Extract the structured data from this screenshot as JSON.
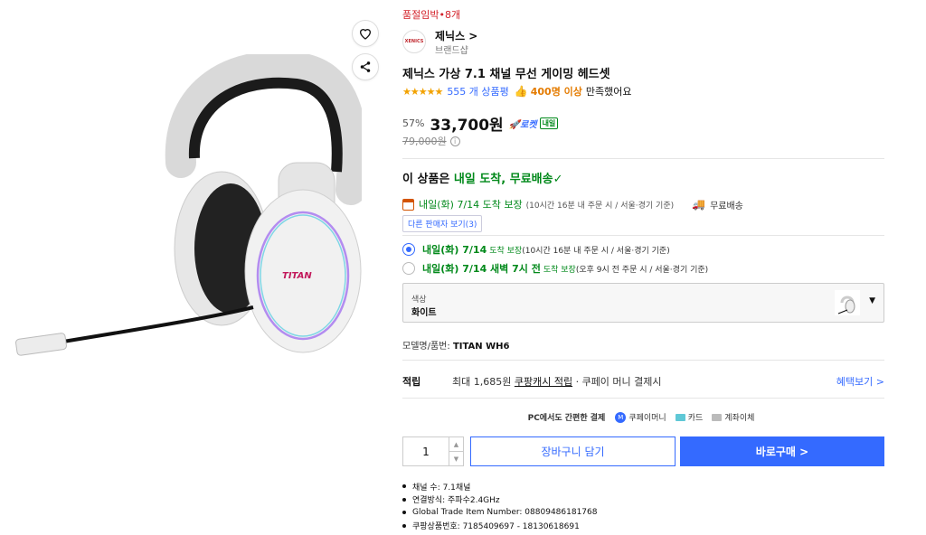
{
  "product_image": {
    "logo_text": "TITAN"
  },
  "actions": {
    "wishlist_icon": "heart-icon",
    "share_icon": "share-icon"
  },
  "sold_badge": "품절임박•8개",
  "brand": {
    "logo_text": "XENICS",
    "name": "제닉스 >",
    "sub": "브랜드샵"
  },
  "title": "제닉스 가상 7.1 채널 무선 게이밍 헤드셋",
  "rating": {
    "stars": "★★★★★",
    "count_text": "555 개 상품평",
    "satisfied_num": "400명 이상",
    "satisfied_text": "만족했어요"
  },
  "price": {
    "discount": "57%",
    "sale": "33,700원",
    "rocket_label": "로켓",
    "naeil_label": "내일",
    "original": "79,000원"
  },
  "shipping": {
    "head_prefix": "이 상품은",
    "head_green": "내일 도착, 무료배송✓",
    "arrive_main": "내일(화) 7/14 도착 보장",
    "arrive_note": "(10시간 16분 내 주문 시 / 서울·경기 기준)",
    "free_ship": "무료배송",
    "other_seller": "다른 판매자 보기(3)"
  },
  "options": [
    {
      "main": "내일(화) 7/14",
      "tag": "도착 보장",
      "note": "(10시간 16분 내 주문 시 / 서울·경기 기준)",
      "selected": true
    },
    {
      "main": "내일(화) 7/14 새벽 7시 전",
      "tag": "도착 보장",
      "note": "(오후 9시 전 주문 시 / 서울·경기 기준)",
      "selected": false
    }
  ],
  "color_select": {
    "label": "색상",
    "value": "화이트"
  },
  "model": {
    "label": "모델명/품번:",
    "value": "TITAN WH6"
  },
  "points": {
    "label": "적립",
    "desc_prefix": "최대 1,685원",
    "desc_link": "쿠팡캐시 적립",
    "desc_suffix": "· 쿠페이 머니 결제시",
    "link": "혜택보기 >"
  },
  "easy_pay": {
    "title": "PC에서도 간편한 결제",
    "coupay": "쿠페이머니",
    "card": "카드",
    "bank": "계좌이체"
  },
  "quantity": "1",
  "buttons": {
    "cart": "장바구니 담기",
    "buy": "바로구매 >"
  },
  "specs": [
    "채널 수: 7.1채널",
    "연결방식: 주파수2.4GHz",
    "Global Trade Item Number: 08809486181768",
    "쿠팡상품번호: 7185409697 - 18130618691"
  ],
  "colors": {
    "accent": "#346aff",
    "green": "#00891a",
    "red": "#d3222a",
    "star": "#f2a200"
  }
}
